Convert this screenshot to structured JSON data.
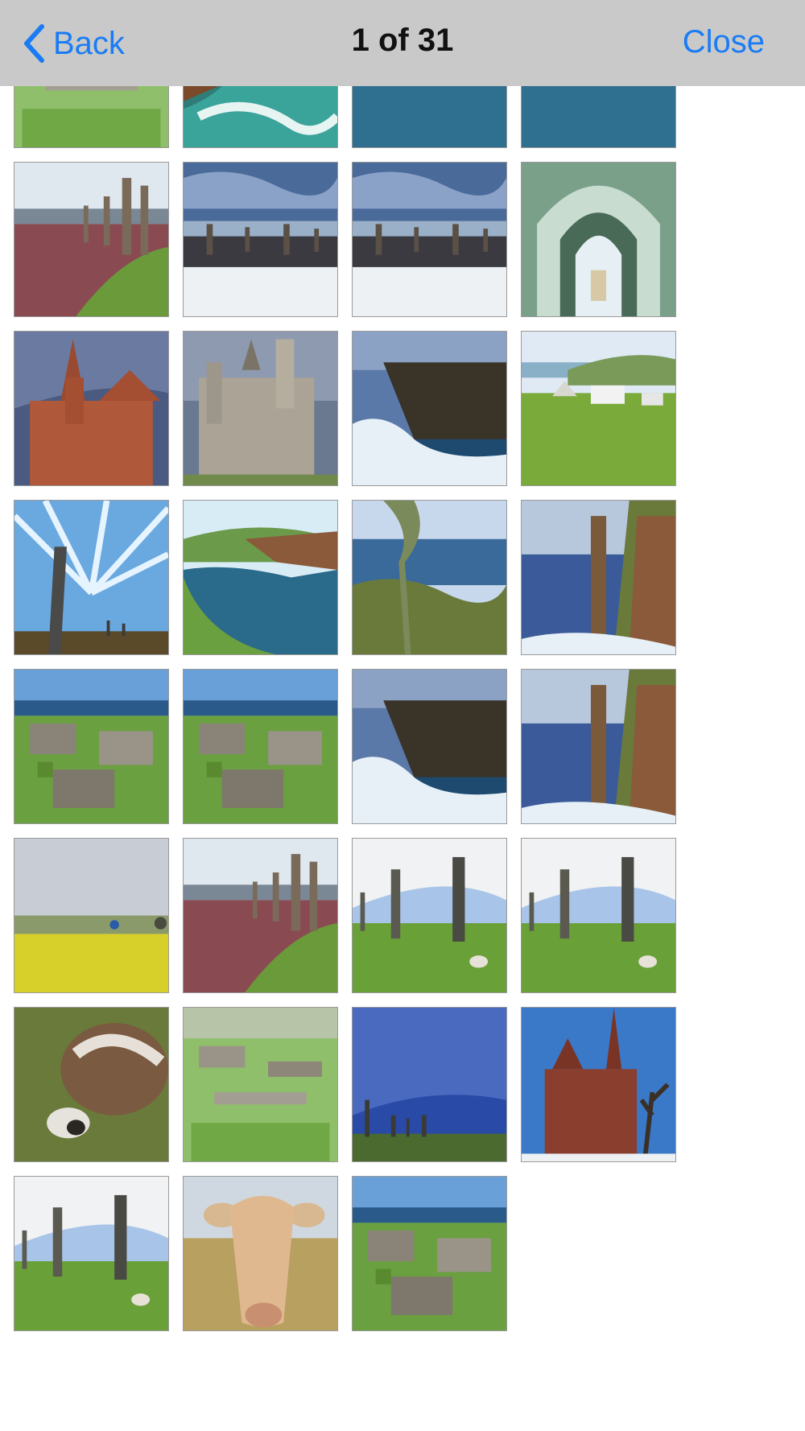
{
  "navbar": {
    "back_label": "Back",
    "title": "1 of 31",
    "close_label": "Close",
    "accent_color": "#1a7cf4",
    "background_color": "#c9c9c9"
  },
  "photos": [
    {
      "subject": "stone ruins on grass",
      "icon": "ruins"
    },
    {
      "subject": "surf on red rocks",
      "icon": "sea-cliff"
    },
    {
      "subject": "harbour houses",
      "icon": "harbour"
    },
    {
      "subject": "harbour houses",
      "icon": "harbour"
    },
    {
      "subject": "standing stones on heather",
      "icon": "stones-sunset"
    },
    {
      "subject": "standing stones in snow",
      "icon": "stones-snow"
    },
    {
      "subject": "standing stones in snow",
      "icon": "stones-snow"
    },
    {
      "subject": "chapel interior",
      "icon": "chapel"
    },
    {
      "subject": "red sandstone cathedral",
      "icon": "cathedral"
    },
    {
      "subject": "grey castle",
      "icon": "castle"
    },
    {
      "subject": "waves against cliffs",
      "icon": "cliff-waves"
    },
    {
      "subject": "camping vehicles on coast",
      "icon": "camping"
    },
    {
      "subject": "standing stone under streaked sky",
      "icon": "stone-sky"
    },
    {
      "subject": "bay with headland",
      "icon": "bay"
    },
    {
      "subject": "rocky shore",
      "icon": "shore"
    },
    {
      "subject": "sea stack",
      "icon": "sea-stack"
    },
    {
      "subject": "neolithic village",
      "icon": "village"
    },
    {
      "subject": "stone houses by the sea",
      "icon": "village"
    },
    {
      "subject": "cliffs and surf",
      "icon": "cliff-waves"
    },
    {
      "subject": "sea stack beside cliff",
      "icon": "sea-stack"
    },
    {
      "subject": "field with yellow flowers",
      "icon": "field"
    },
    {
      "subject": "standing stones at sunset",
      "icon": "stones-sunset"
    },
    {
      "subject": "standing stones with sheep",
      "icon": "stones-green"
    },
    {
      "subject": "tall standing stones",
      "icon": "stones-green"
    },
    {
      "subject": "grazing sheep",
      "icon": "sheep"
    },
    {
      "subject": "stone broch",
      "icon": "ruins"
    },
    {
      "subject": "stone circle under blue sky",
      "icon": "stones-blue"
    },
    {
      "subject": "cathedral with trees",
      "icon": "cathedral-blue"
    },
    {
      "subject": "standing stones on grass",
      "icon": "stones-green"
    },
    {
      "subject": "cow",
      "icon": "cow"
    },
    {
      "subject": "coastal settlement ruins",
      "icon": "village"
    }
  ]
}
